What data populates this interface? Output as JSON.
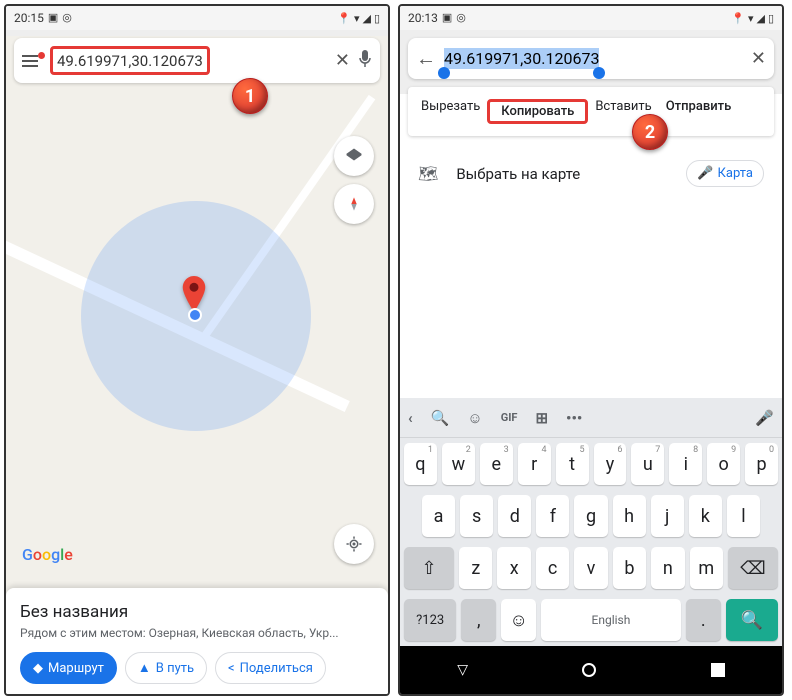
{
  "statusBar": {
    "timeLeft": "20:15",
    "timeRight": "20:13"
  },
  "left": {
    "search": {
      "coords": "49.619971,30.120673"
    },
    "card": {
      "title": "Без названия",
      "subtitle": "Рядом с этим местом: Озерная, Киевская область, Укр...",
      "routeBtn": "Маршрут",
      "startBtn": "В путь",
      "shareBtn": "Поделиться"
    },
    "marker": "1"
  },
  "right": {
    "search": {
      "coords": "49.619971,30.120673"
    },
    "contextMenu": {
      "cut": "Вырезать",
      "copy": "Копировать",
      "paste": "Вставить",
      "send": "Отправить"
    },
    "selectOnMap": "Выбрать на карте",
    "mapChip": "Карта",
    "marker": "2",
    "keyboard": {
      "gif": "GIF",
      "row1": [
        "q",
        "w",
        "e",
        "r",
        "t",
        "y",
        "u",
        "i",
        "o",
        "p"
      ],
      "nums": [
        "1",
        "2",
        "3",
        "4",
        "5",
        "6",
        "7",
        "8",
        "9",
        "0"
      ],
      "row2": [
        "a",
        "s",
        "d",
        "f",
        "g",
        "h",
        "j",
        "k",
        "l"
      ],
      "row3": [
        "z",
        "x",
        "c",
        "v",
        "b",
        "n",
        "m"
      ],
      "shift": "⇧",
      "backspace": "⌫",
      "symbols": "?123",
      "comma": ",",
      "space": "English",
      "period": "."
    }
  }
}
